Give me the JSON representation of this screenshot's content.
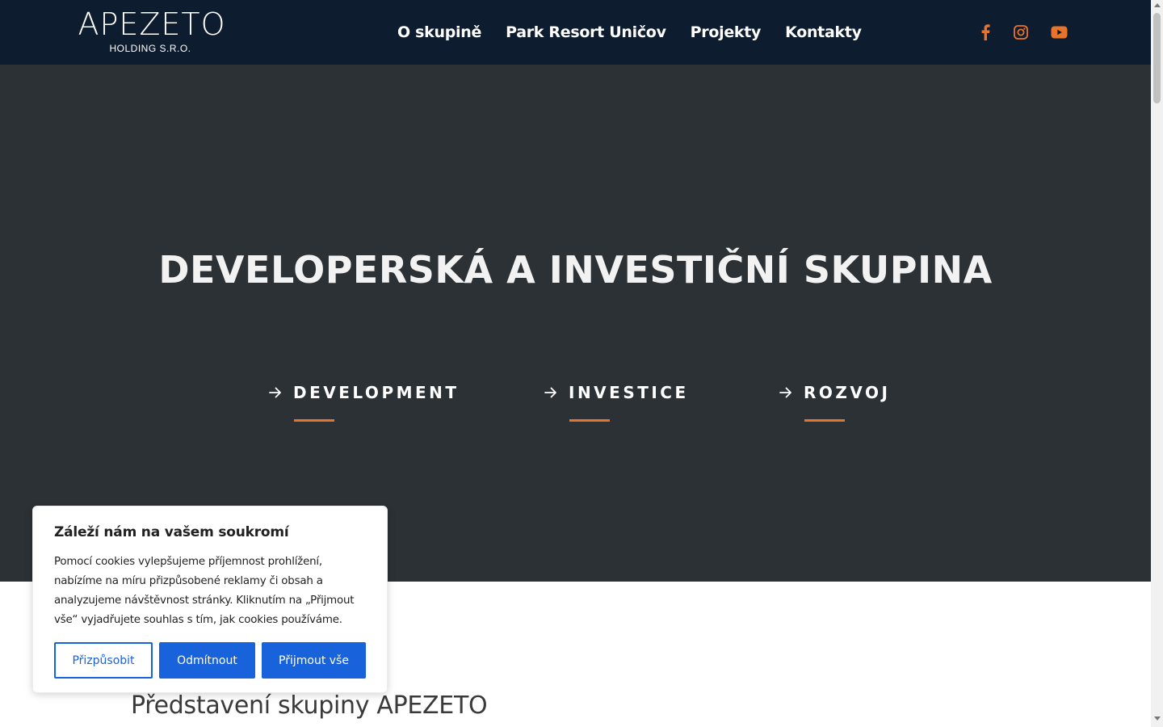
{
  "header": {
    "logo": {
      "main": "APEZETO",
      "sub": "HOLDING S.R.O."
    },
    "nav": [
      {
        "label": "O skupině"
      },
      {
        "label": "Park Resort Uničov"
      },
      {
        "label": "Projekty"
      },
      {
        "label": "Kontakty"
      }
    ],
    "social": [
      {
        "icon": "facebook-icon"
      },
      {
        "icon": "instagram-icon"
      },
      {
        "icon": "youtube-icon"
      }
    ],
    "background": "#0e1c2f",
    "accent": "#e8742b"
  },
  "hero": {
    "title": "DEVELOPERSKÁ A INVESTIČNÍ SKUPINA",
    "background": "#2c3135",
    "pillars": [
      {
        "label": "DEVELOPMENT",
        "icon": "arrow-right-icon"
      },
      {
        "label": "INVESTICE",
        "icon": "arrow-right-icon"
      },
      {
        "label": "ROZVOJ",
        "icon": "arrow-right-icon"
      }
    ]
  },
  "section": {
    "title": "Představení skupiny APEZETO"
  },
  "cookie": {
    "title": "Záleží nám na vašem soukromí",
    "text": "Pomocí cookies vylepšujeme příjemnost prohlížení, nabízíme na míru přizpůsobené reklamy či obsah a analyzujeme návštěvnost stránky. Kliknutím na „Přijmout vše“ vyjadřujete souhlas s tím, jak cookies používáme.",
    "buttons": {
      "customize": "Přizpůsobit",
      "reject": "Odmítnout",
      "accept": "Přijmout vše"
    },
    "button_color": "#1863dc"
  }
}
